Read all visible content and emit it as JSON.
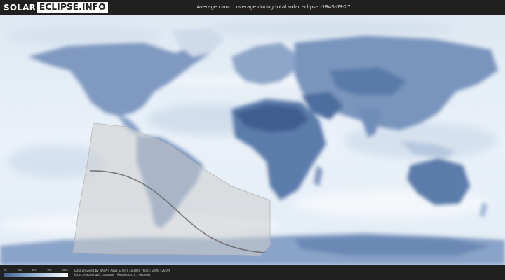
{
  "header": {
    "logo_part1": "SOLAR",
    "logo_part2": "ECLIPSE.INFO",
    "title": "Average cloud coverage during total solar eclipse -1846-09-27"
  },
  "legend": {
    "ticks": [
      "0%",
      "25%",
      "50%",
      "75%",
      "100%"
    ],
    "colors": [
      "#3f5f8f",
      "#7f9cc4",
      "#bcd0e6",
      "#ffffff"
    ]
  },
  "footer": {
    "credit_line1": "Data provided by NASA's Aqua & Terra satellite (Years: 2000 - 2019)",
    "credit_line2": "https://neo.sci.gsfc.nasa.gov | Resolution: 0.1 degrees"
  },
  "map": {
    "ocean_color": "#e7eef6",
    "land_color": "#5f7fae",
    "eclipse_shadow_color": "#c9c9c9",
    "path_line_color": "#6f6f6f"
  }
}
